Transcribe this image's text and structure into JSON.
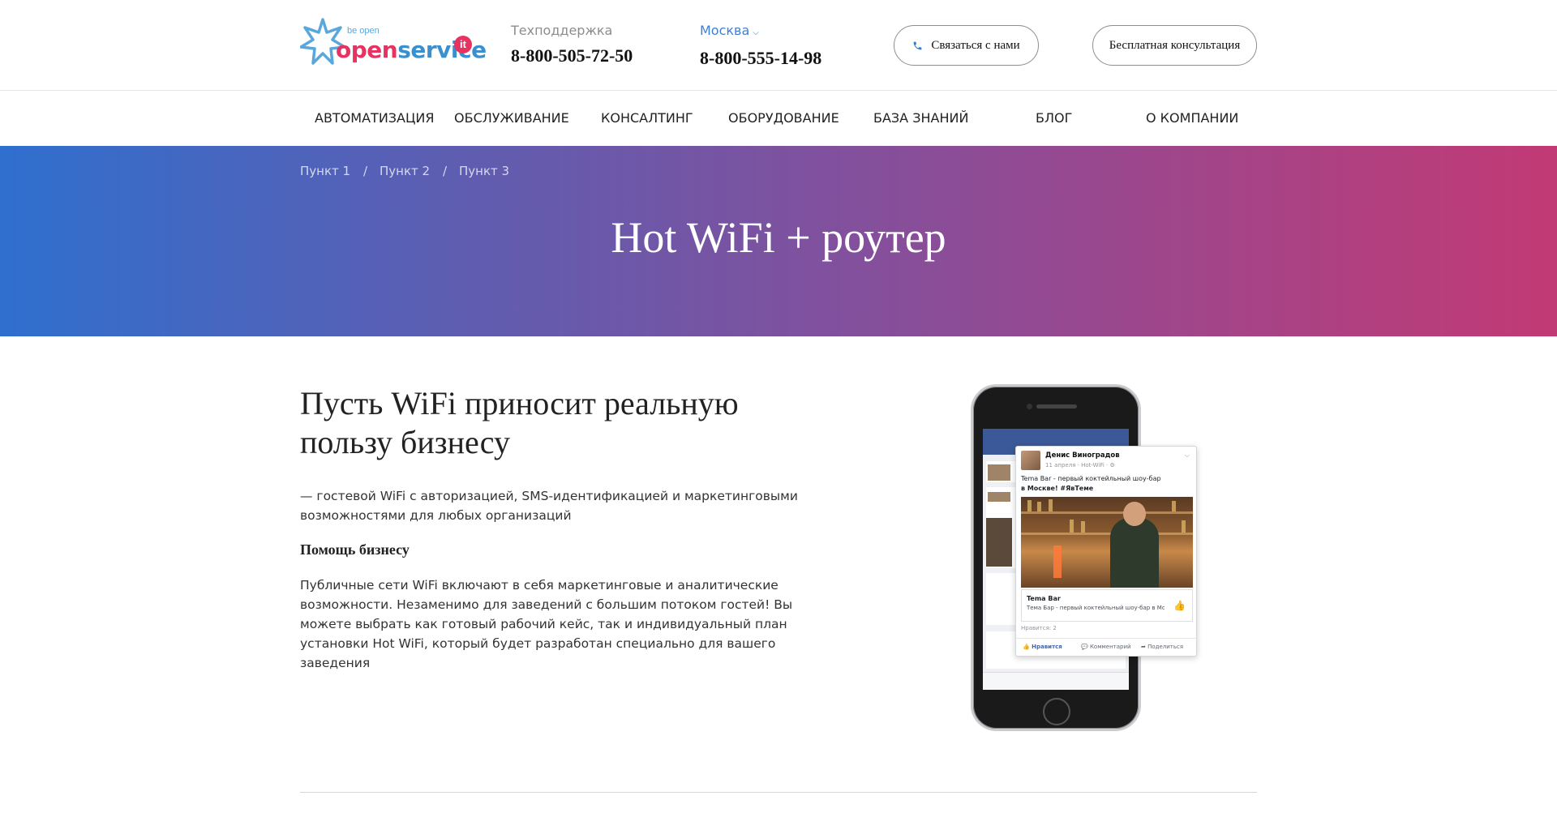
{
  "header": {
    "logo": {
      "tagline": "be open",
      "word1": "open",
      "word2": "service",
      "badge": "it"
    },
    "support": {
      "label": "Техподдержка",
      "phone": "8-800-505-72-50"
    },
    "city": {
      "label": "Москва",
      "phone": "8-800-555-14-98"
    },
    "contact_button": "Связаться с нами",
    "consult_button": "Бесплатная консультация"
  },
  "nav": {
    "items": [
      "АВТОМАТИЗАЦИЯ",
      "ОБСЛУЖИВАНИЕ",
      "КОНСАЛТИНГ",
      "ОБОРУДОВАНИЕ",
      "БАЗА ЗНАНИЙ",
      "БЛОГ",
      "О КОМПАНИИ"
    ]
  },
  "hero": {
    "breadcrumbs": [
      "Пункт 1",
      "Пункт 2",
      "Пункт 3"
    ],
    "separator": "/",
    "title": "Hot WiFi + роутер",
    "gradient": [
      "#2f6fce",
      "#c23a75"
    ]
  },
  "content": {
    "heading": "Пусть WiFi приносит реальную пользу бизнесу",
    "lead": "— гостевой WiFi с авторизацией, SMS-идентификацией и маркетинговыми возможностями для любых организаций",
    "subheading": "Помощь бизнесу",
    "body": "Публичные сети WiFi включают в себя маркетинговые и аналитические возможности. Незаменимо для заведений с большим потоком гостей! Вы можете выбрать как готовый рабочий кейс, так и индивидуальный план установки Hot WiFi, который будет разработан специально для вашего заведения"
  },
  "post": {
    "author": "Денис Виноградов",
    "meta": "11 апреля · Hot-WiFi · ⚙",
    "text_line1": "Tema Bar - первый коктейльный шоу-бар",
    "text_line2": "в Москве! #ЯвТеме",
    "link_title": "Tema Bar",
    "link_desc": "Тема Бар - первый коктейльный шоу-бар в Мос...",
    "likes": "Нравится: 2",
    "actions": [
      "Нравится",
      "Комментарий",
      "Поделиться"
    ]
  }
}
